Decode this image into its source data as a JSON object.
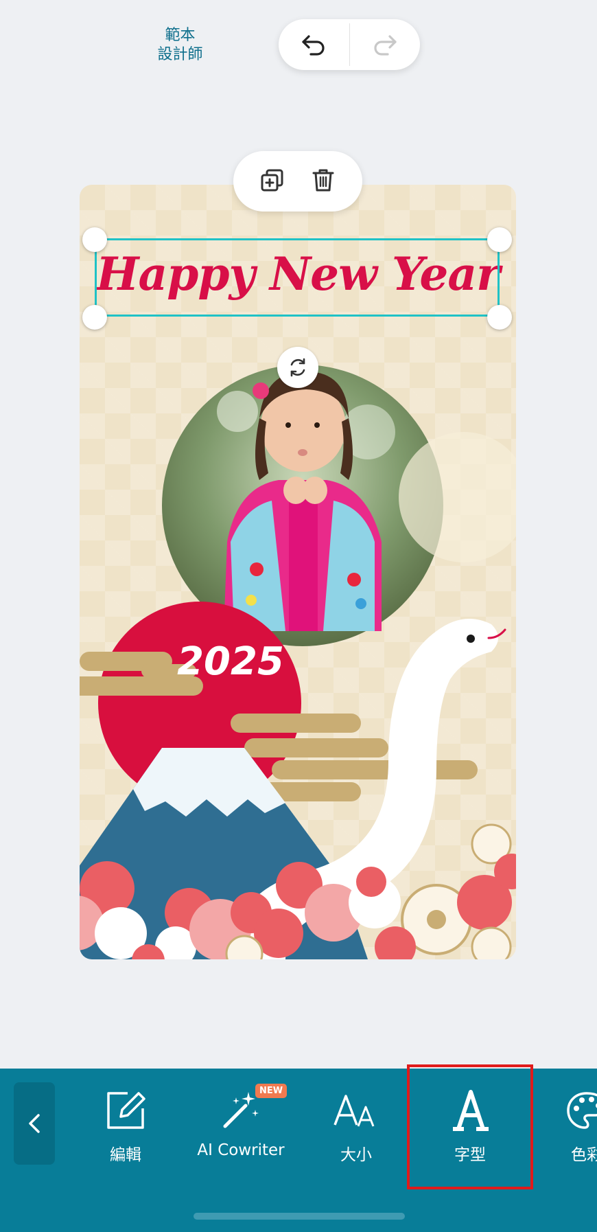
{
  "header": {
    "template_designer_line1": "範本",
    "template_designer_line2": "設計師"
  },
  "card": {
    "title": "Happy New Year",
    "year": "2025"
  },
  "toolbar": {
    "items": [
      {
        "label": "編輯",
        "icon": "edit-icon"
      },
      {
        "label": "AI Cowriter",
        "icon": "magic-wand-icon",
        "badge": "NEW"
      },
      {
        "label": "大小",
        "icon": "font-size-icon"
      },
      {
        "label": "字型",
        "icon": "font-icon",
        "selected": true
      },
      {
        "label": "色彩",
        "icon": "palette-icon"
      }
    ]
  },
  "colors": {
    "toolbar": "#087d98",
    "accent_red": "#d80f48",
    "selection": "#1fc2c6",
    "highlight": "#e01b1b"
  }
}
